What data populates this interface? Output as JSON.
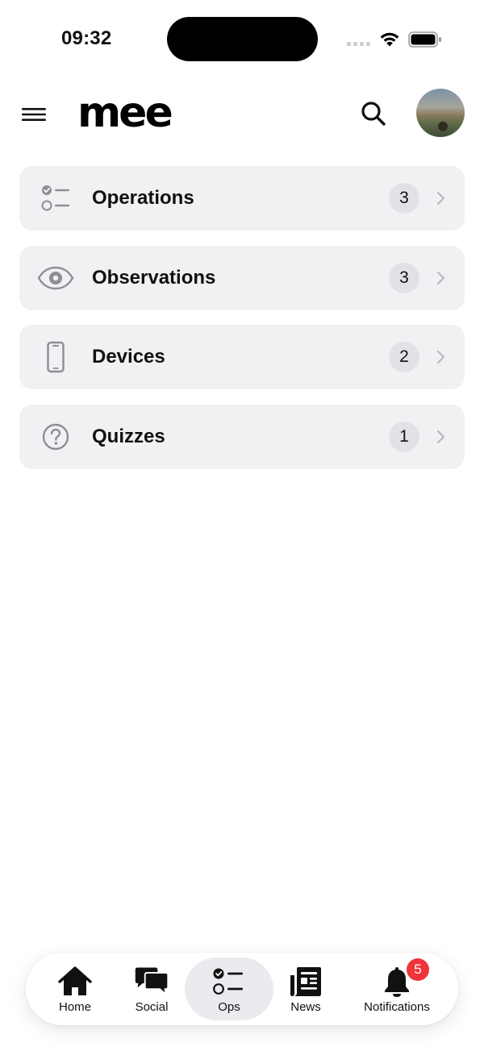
{
  "status_bar": {
    "time": "09:32"
  },
  "header": {
    "logo": "mee"
  },
  "colors": {
    "row_bg": "#f1f1f4",
    "count_bg": "#e2e2e6",
    "badge": "#f0343c",
    "active_tab": "#ebebef",
    "icon_gray": "#8e8e93"
  },
  "list": [
    {
      "label": "Operations",
      "count": "3",
      "icon": "checklist-icon"
    },
    {
      "label": "Observations",
      "count": "3",
      "icon": "eye-icon"
    },
    {
      "label": "Devices",
      "count": "2",
      "icon": "phone-icon"
    },
    {
      "label": "Quizzes",
      "count": "1",
      "icon": "question-circle-icon"
    }
  ],
  "tabs": [
    {
      "label": "Home",
      "icon": "house-icon",
      "active": false
    },
    {
      "label": "Social",
      "icon": "chat-bubbles-icon",
      "active": false
    },
    {
      "label": "Ops",
      "icon": "checklist-icon",
      "active": true
    },
    {
      "label": "News",
      "icon": "newspaper-icon",
      "active": false
    },
    {
      "label": "Notifications",
      "icon": "bell-icon",
      "active": false
    }
  ],
  "notifications_badge": "5"
}
